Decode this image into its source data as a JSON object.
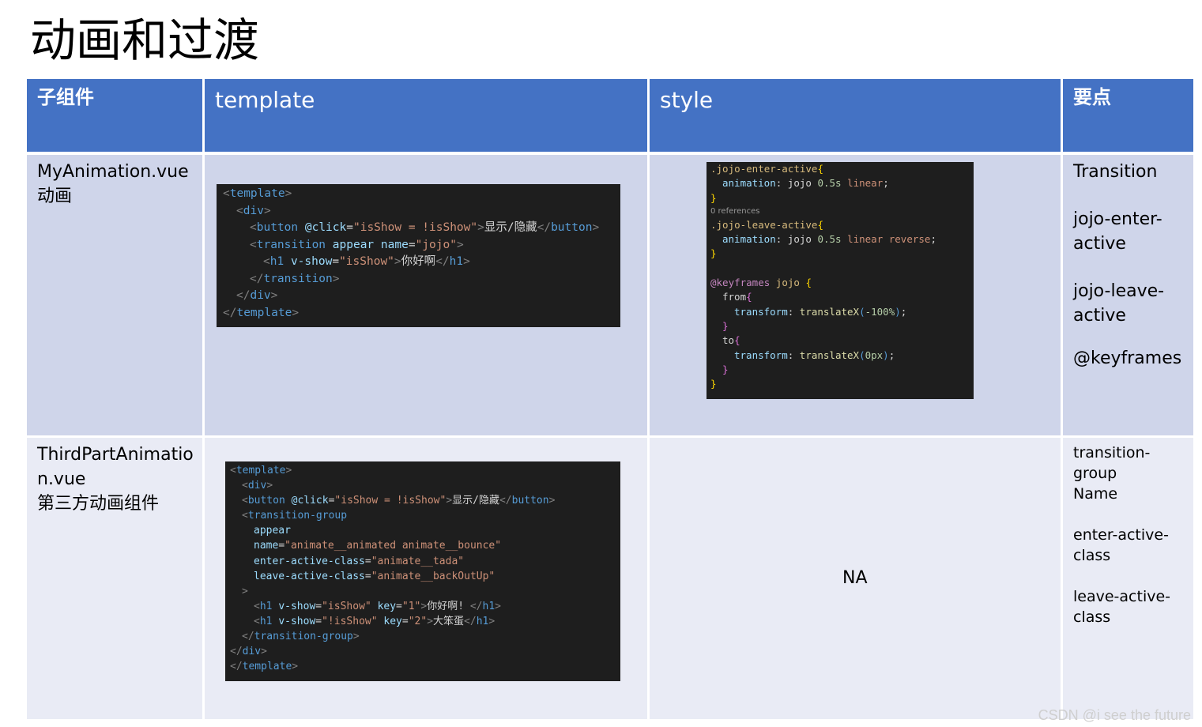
{
  "title": "动画和过渡",
  "headers": [
    "子组件",
    "template",
    "style",
    "要点"
  ],
  "rows": [
    {
      "component": "MyAnimation.vue\n动画",
      "points": [
        "Transition",
        "jojo-enter-\nactive",
        "jojo-leave-\nactive",
        "@keyframes"
      ]
    },
    {
      "component": "ThirdPartAnimatio\nn.vue\n第三方动画组件",
      "style_text": "NA",
      "points": [
        "transition-group",
        "Name",
        "enter-active-\nclass",
        "leave-active-\nclass"
      ]
    }
  ],
  "code": {
    "t1": {
      "l1a": "<",
      "l1b": "template",
      "l1c": ">",
      "l2a": "<",
      "l2b": "div",
      "l2c": ">",
      "l3a": "<",
      "l3b": "button",
      "l3c": "@click",
      "l3d": "=",
      "l3e": "\"isShow = !isShow\"",
      "l3f": ">",
      "l3g": "显示/隐藏",
      "l3h": "</",
      "l3i": "button",
      "l3j": ">",
      "l4a": "<",
      "l4b": "transition",
      "l4c": "appear",
      "l4d": "name",
      "l4e": "=",
      "l4f": "\"jojo\"",
      "l4g": ">",
      "l5a": "<",
      "l5b": "h1",
      "l5c": "v-show",
      "l5d": "=",
      "l5e": "\"isShow\"",
      "l5f": ">",
      "l5g": "你好啊",
      "l5h": "</",
      "l5i": "h1",
      "l5j": ">",
      "l6a": "</",
      "l6b": "transition",
      "l6c": ">",
      "l7a": "</",
      "l7b": "div",
      "l7c": ">",
      "l8a": "</",
      "l8b": "template",
      "l8c": ">"
    },
    "s1": {
      "l1": ".jojo-enter-active",
      "l1b": "{",
      "l2a": "animation",
      "l2b": ":",
      "l2c": "jojo",
      "l2d": "0.5s",
      "l2e": "linear",
      "l2f": ";",
      "l3": "}",
      "ref": "0 references",
      "l4": ".jojo-leave-active",
      "l4b": "{",
      "l5a": "animation",
      "l5b": ":",
      "l5c": "jojo",
      "l5d": "0.5s",
      "l5e": "linear reverse",
      "l5f": ";",
      "l6": "}",
      "l7a": "@keyframes",
      "l7b": "jojo",
      "l7c": "{",
      "l8a": "from",
      "l8b": "{",
      "l9a": "transform",
      "l9b": ":",
      "l9c": "translateX",
      "l9d": "(",
      "l9e": "-100%",
      "l9f": ")",
      "l9g": ";",
      "l10": "}",
      "l11a": "to",
      "l11b": "{",
      "l12a": "transform",
      "l12b": ":",
      "l12c": "translateX",
      "l12d": "(",
      "l12e": "0px",
      "l12f": ")",
      "l12g": ";",
      "l13": "}",
      "l14": "}"
    },
    "t2": {
      "l1a": "<",
      "l1b": "template",
      "l1c": ">",
      "l2a": "<",
      "l2b": "div",
      "l2c": ">",
      "l3a": "<",
      "l3b": "button",
      "l3c": "@click",
      "l3d": "=",
      "l3e": "\"isShow = !isShow\"",
      "l3f": ">",
      "l3g": "显示/隐藏",
      "l3h": "</",
      "l3i": "button",
      "l3j": ">",
      "l4a": "<",
      "l4b": "transition-group",
      "l5": "appear",
      "l6a": "name",
      "l6b": "=",
      "l6c": "\"animate__animated animate__bounce\"",
      "l7a": "enter-active-class",
      "l7b": "=",
      "l7c": "\"animate__tada\"",
      "l8a": "leave-active-class",
      "l8b": "=",
      "l8c": "\"animate__backOutUp\"",
      "l9": ">",
      "l10a": "<",
      "l10b": "h1",
      "l10c": "v-show",
      "l10d": "=",
      "l10e": "\"isShow\"",
      "l10f": "key",
      "l10g": "=",
      "l10h": "\"1\"",
      "l10i": ">",
      "l10j": "你好啊! ",
      "l10k": "</",
      "l10l": "h1",
      "l10m": ">",
      "l11a": "<",
      "l11b": "h1",
      "l11c": "v-show",
      "l11d": "=",
      "l11e": "\"!isShow\"",
      "l11f": "key",
      "l11g": "=",
      "l11h": "\"2\"",
      "l11i": ">",
      "l11j": "大笨蛋",
      "l11k": "</",
      "l11l": "h1",
      "l11m": ">",
      "l12a": "</",
      "l12b": "transition-group",
      "l12c": ">",
      "l13a": "</",
      "l13b": "div",
      "l13c": ">",
      "l14a": "</",
      "l14b": "template",
      "l14c": ">"
    }
  },
  "watermark": "CSDN @i see the future"
}
